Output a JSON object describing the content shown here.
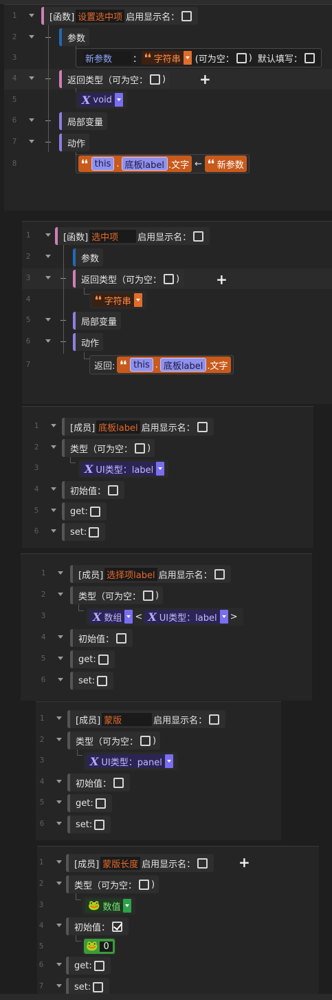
{
  "panels": {
    "setter": {
      "ln": [
        "1",
        "2",
        "3",
        "4",
        "5",
        "6",
        "7",
        "8"
      ],
      "header": {
        "tag": "[函数]",
        "name": "设置选中项",
        "show_name_label": "启用显示名："
      },
      "params_label": "参数",
      "param": {
        "name": "新参数",
        "colon": "：",
        "type": "字符串",
        "nullable_label": "(可为空：",
        "close": ")",
        "default_label": "默认填写："
      },
      "return_label": "返回类型（可为空：",
      "return_close": ")",
      "return_type": "void",
      "locals_label": "局部变量",
      "actions_label": "动作",
      "stmt": {
        "this": "this",
        "dot1": ".",
        "target": "底板label",
        "field": ".文字",
        "arrow": "←",
        "value": "新参数"
      }
    },
    "getter": {
      "ln": [
        "1",
        "2",
        "3",
        "4",
        "5",
        "6",
        "7"
      ],
      "header": {
        "tag": "[函数]",
        "name": "选中项",
        "show_name_label": "启用显示名："
      },
      "params_label": "参数",
      "return_label": "返回类型（可为空：",
      "return_close": ")",
      "return_type": "字符串",
      "locals_label": "局部变量",
      "actions_label": "动作",
      "stmt": {
        "prefix": "返回:",
        "this": "this",
        "dot1": ".",
        "target": "底板label",
        "field": ".文字"
      }
    },
    "member1": {
      "ln": [
        "1",
        "2",
        "3",
        "4",
        "5",
        "6"
      ],
      "header": {
        "tag": "[成员]",
        "name": "底板label",
        "show_name_label": "启用显示名："
      },
      "type_label": "类型（可为空：",
      "type_close": ")",
      "type_value": "UI类型：label",
      "init_label": "初始值：",
      "get_label": "get:",
      "set_label": "set:"
    },
    "member2": {
      "ln": [
        "1",
        "2",
        "3",
        "4",
        "5",
        "6"
      ],
      "header": {
        "tag": "[成员]",
        "name": "选择项label",
        "show_name_label": "启用显示名："
      },
      "type_label": "类型（可为空：",
      "type_close": ")",
      "type_array": "数组",
      "lt": "<",
      "type_value": "UI类型：label",
      "gt": ">",
      "init_label": "初始值：",
      "get_label": "get:",
      "set_label": "set:"
    },
    "member3": {
      "ln": [
        "1",
        "2",
        "3",
        "4",
        "5",
        "6"
      ],
      "header": {
        "tag": "[成员]",
        "name": "蒙版",
        "show_name_label": "启用显示名："
      },
      "type_label": "类型（可为空：",
      "type_close": ")",
      "type_value": "UI类型：panel",
      "init_label": "初始值：",
      "get_label": "get:",
      "set_label": "set:"
    },
    "member4": {
      "ln": [
        "1",
        "2",
        "3",
        "4",
        "5",
        "6",
        "7"
      ],
      "header": {
        "tag": "[成员]",
        "name": "蒙版长度",
        "show_name_label": "启用显示名："
      },
      "type_label": "类型（可为空：",
      "type_close": ")",
      "type_value": "数值",
      "init_label": "初始值：",
      "init_value": "0",
      "get_label": "get:",
      "set_label": "set:"
    }
  },
  "colors": {
    "function_bar": "#cf7fb6",
    "params_bar": "#1f6bb7",
    "body_bar": "#8e7fe0",
    "name_text": "#e46a2a",
    "string_type": "#e06d2c",
    "ui_type": "#7a6ef0",
    "number_type": "#2ea24b"
  },
  "icons": {
    "type": "type-x-icon",
    "string": "quote-icon",
    "number": "frog-number-icon",
    "dropdown": "dropdown-arrow-icon",
    "add": "plus-icon",
    "collapse": "chevron-down-icon"
  }
}
